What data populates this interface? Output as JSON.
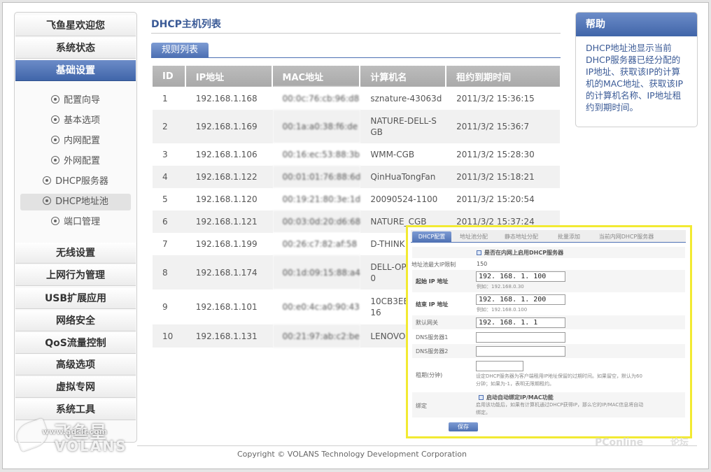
{
  "sidebar": {
    "top_items": [
      {
        "label": "飞鱼星欢迎您"
      },
      {
        "label": "系统状态"
      },
      {
        "label": "基础设置"
      }
    ],
    "sub_items": [
      {
        "label": "配置向导"
      },
      {
        "label": "基本选项"
      },
      {
        "label": "内网配置"
      },
      {
        "label": "外网配置"
      },
      {
        "label": "DHCP服务器"
      },
      {
        "label": "DHCP地址池"
      },
      {
        "label": "端口管理"
      }
    ],
    "bottom_items": [
      {
        "label": "无线设置"
      },
      {
        "label": "上网行为管理"
      },
      {
        "label": "USB扩展应用"
      },
      {
        "label": "网络安全"
      },
      {
        "label": "QoS流量控制"
      },
      {
        "label": "高级选项"
      },
      {
        "label": "虚拟专网"
      },
      {
        "label": "系统工具"
      }
    ],
    "brand": {
      "cn": "飞鱼星",
      "url": "www.adslr.com",
      "en": "VOLANS"
    }
  },
  "main": {
    "title": "DHCP主机列表",
    "tab": "规则列表",
    "table": {
      "headers": [
        "ID",
        "IP地址",
        "MAC地址",
        "计算机名",
        "租约到期时间"
      ],
      "rows": [
        {
          "id": "1",
          "ip": "192.168.1.168",
          "mac": "00:0c:76:cb:96:d8",
          "name": "sznature-43063d",
          "expire": "2011/3/2 15:36:15"
        },
        {
          "id": "2",
          "ip": "192.168.1.169",
          "mac": "00:1a:a0:38:f6:de",
          "name": "NATURE-DELL-S",
          "name2": "GB",
          "expire": "2011/3/2 15:36:7"
        },
        {
          "id": "3",
          "ip": "192.168.1.106",
          "mac": "00:16:ec:53:88:3b",
          "name": "WMM-CGB",
          "expire": "2011/3/2 15:28:30"
        },
        {
          "id": "4",
          "ip": "192.168.1.122",
          "mac": "00:01:01:76:88:6d",
          "name": "QinHuaTongFan",
          "expire": "2011/3/2 15:18:21"
        },
        {
          "id": "5",
          "ip": "192.168.1.120",
          "mac": "00:19:21:80:3e:1d",
          "name": "20090524-1100",
          "expire": "2011/3/2 15:20:54"
        },
        {
          "id": "6",
          "ip": "192.168.1.121",
          "mac": "00:03:0d:20:d6:68",
          "name": "NATURE_CGB",
          "expire": "2011/3/2 15:37:24"
        },
        {
          "id": "7",
          "ip": "192.168.1.199",
          "mac": "00:26:c7:82:af:58",
          "name": "D-THINK",
          "expire": ""
        },
        {
          "id": "8",
          "ip": "192.168.1.174",
          "mac": "00:1d:09:15:88:a4",
          "name": "DELL-OP",
          "name2": "0",
          "expire": ""
        },
        {
          "id": "9",
          "ip": "192.168.1.101",
          "mac": "00:e0:4c:a0:90:43",
          "name": "10CB3EE",
          "name2": "16",
          "expire": ""
        },
        {
          "id": "10",
          "ip": "192.168.1.131",
          "mac": "00:21:97:ab:c2:be",
          "name": "LENOVO",
          "expire": ""
        }
      ]
    }
  },
  "help": {
    "title": "帮助",
    "lines": [
      "DHCP地址池显示当前",
      "DHCP服务器已经分配的",
      "IP地址、获取该IP的计算",
      "机的MAC地址、获取该IP",
      "的计算机名称、IP地址租",
      "约到期时间。"
    ]
  },
  "overlay": {
    "tabs": [
      "DHCP配置",
      "地址池分配",
      "静态地址分配",
      "批量添加",
      "当前内网DHCP服务器"
    ],
    "enable_label": "是否在内网上启用DHCP服务器",
    "pool_max_label": "地址池最大IP限制",
    "pool_max_value": "150",
    "start_label": "起始 IP 地址",
    "start_value": "192. 168. 1. 100",
    "start_example": "例如：192.168.0.30",
    "end_label": "结束 IP 地址",
    "end_value": "192. 168. 1. 200",
    "end_example": "例如：192.168.0.100",
    "gateway_label": "默认网关",
    "gateway_value": "192. 168. 1. 1",
    "dns1_label": "DNS服务器1",
    "dns2_label": "DNS服务器2",
    "lease_label": "租期(分钟)",
    "lease_desc1": "设定DHCP服务器为客户端租用IP地址保留的过期时间。如果留空，默认为60",
    "lease_desc2": "分钟；如果为-1，表明无限期租约。",
    "bind_label": "绑定",
    "bind_check": "启动自动绑定IP/MAC功能",
    "bind_desc1": "启用该功能后，如果有计算机通过DHCP获得IP，那么它的IP/MAC信息将自动",
    "bind_desc2": "绑定。",
    "save": "保存"
  },
  "footer": {
    "copyright": "Copyright © VOLANS Technology Development Corporation",
    "wm1": "PConline",
    "wm2": "论坛"
  }
}
